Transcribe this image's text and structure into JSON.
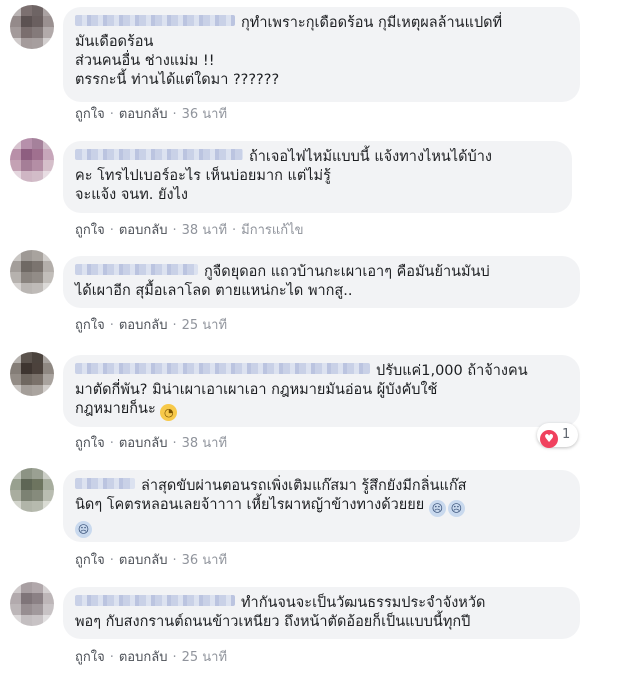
{
  "comments": [
    {
      "text_lines": [
        "กุทำเพราะกุเดือดร้อน กุมีเหตุผลล้านแปดที่",
        "มันเดือดร้อน",
        "ส่วนคนอื่น ช่างแม่ม !!",
        "ตรรกะนี้ ท่านได้แต่ใดมา ??????"
      ],
      "actions": {
        "like": "ถูกใจ",
        "reply": "ตอบกลับ",
        "time": "36 นาที"
      }
    },
    {
      "text_lines": [
        "ถ้าเจอไฟไหม้แบบนี้ แจ้งทางไหนได้บ้าง",
        "คะ โทรไปเบอร์อะไร เห็นบ่อยมาก แต่ไม่รู้",
        "จะแจ้ง จนท. ยังไง"
      ],
      "actions": {
        "like": "ถูกใจ",
        "reply": "ตอบกลับ",
        "time": "38 นาที",
        "edited": "มีการแก้ไข"
      }
    },
    {
      "text_lines": [
        "กูจืดยุดอก แถวบ้านกะเผาเอาๆ คือมันย้านมันบ่",
        "ได้เผาอีก สุมื้อเลาโลด ตายแหน่กะได พากสู.."
      ],
      "actions": {
        "like": "ถูกใจ",
        "reply": "ตอบกลับ",
        "time": "25 นาที"
      }
    },
    {
      "text_lines": [
        "ปรับแค่1,000 ถ้าจ้างคน",
        "มาตัดกี่พัน? มิน่าเผาเอาเผาเอา กฎหมายมันอ่อน ผู้บังคับใช้",
        "กฎหมายก็นะ"
      ],
      "actions": {
        "like": "ถูกใจ",
        "reply": "ตอบกลับ",
        "time": "38 นาที"
      },
      "reaction_count": "1"
    },
    {
      "text_lines": [
        "ล่าสุดขับผ่านตอนรถเพิ่งเติมแก๊สมา รู้สึกยังมีกลิ่นแก๊ส",
        "นิดๆ โคตรหลอนเลยจ้าาาา เหี้ยไรผาหญ้าข้างทางด้วยยย"
      ],
      "actions": {
        "like": "ถูกใจ",
        "reply": "ตอบกลับ",
        "time": "36 นาที"
      }
    },
    {
      "text_lines": [
        "ทำกันจนจะเป็นวัฒนธรรมประจำจังหวัด",
        "พอๆ กับสงกรานต์ถนนข้าวเหนียว ถึงหน้าตัดอ้อยก็เป็นแบบนี้ทุกปี"
      ],
      "actions": {
        "like": "ถูกใจ",
        "reply": "ตอบกลับ",
        "time": "25 นาที"
      }
    }
  ],
  "icons": {
    "eye_roll": "eye-roll-emoji-icon",
    "scream": "scream-emoji-icon",
    "heart": "heart-reaction-icon"
  },
  "colors": {
    "bubble": "#f2f3f5",
    "action_link": "#4b4f56",
    "meta_text": "#90949c",
    "heart": "#f0415e"
  }
}
